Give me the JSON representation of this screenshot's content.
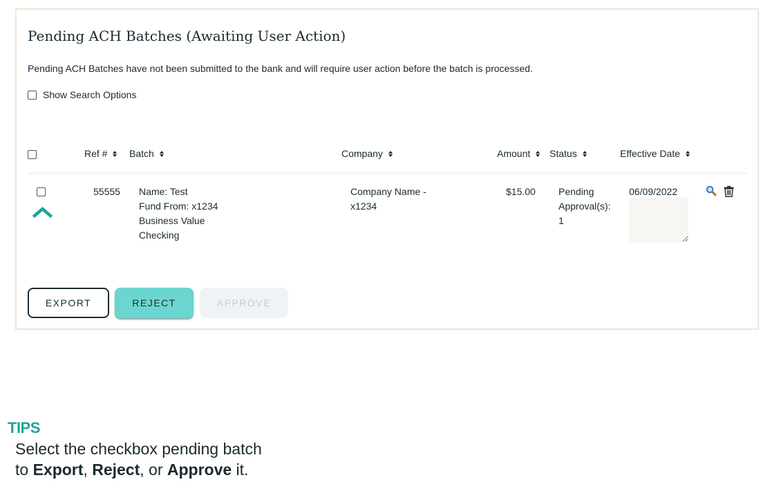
{
  "panel": {
    "title": "Pending ACH Batches (Awaiting User Action)",
    "description": "Pending ACH Batches have not been submitted to the bank and will require user action before the batch is processed.",
    "show_search_label": "Show Search Options"
  },
  "table": {
    "columns": {
      "ref": "Ref #",
      "batch": "Batch",
      "company": "Company",
      "amount": "Amount",
      "status": "Status",
      "effective_date": "Effective Date"
    },
    "rows": [
      {
        "ref": "55555",
        "batch_lines": [
          "Name: Test",
          "Fund From: x1234",
          "Business Value",
          "Checking"
        ],
        "company_lines": [
          "Company Name -",
          "x1234"
        ],
        "amount": "$15.00",
        "status_lines": [
          "Pending",
          "Approval(s):",
          "1"
        ],
        "effective_date": "06/09/2022"
      }
    ]
  },
  "icons": {
    "expand": "chevron-up-icon",
    "view": "magnifier-icon",
    "delete": "trash-icon"
  },
  "buttons": {
    "export": "EXPORT",
    "reject": "REJECT",
    "approve": "APPROVE"
  },
  "tips": {
    "title": "TIPS",
    "line1": "Select the checkbox pending batch",
    "to": "to ",
    "export": "Export",
    "sep1": ", ",
    "reject": "Reject",
    "sep2": ", or ",
    "approve": "Approve",
    "end": " it."
  },
  "colors": {
    "accent": "#1da599",
    "reject_button": "#6bd6cf",
    "panel_border": "#efe4d6",
    "text": "#1b2a2f"
  }
}
